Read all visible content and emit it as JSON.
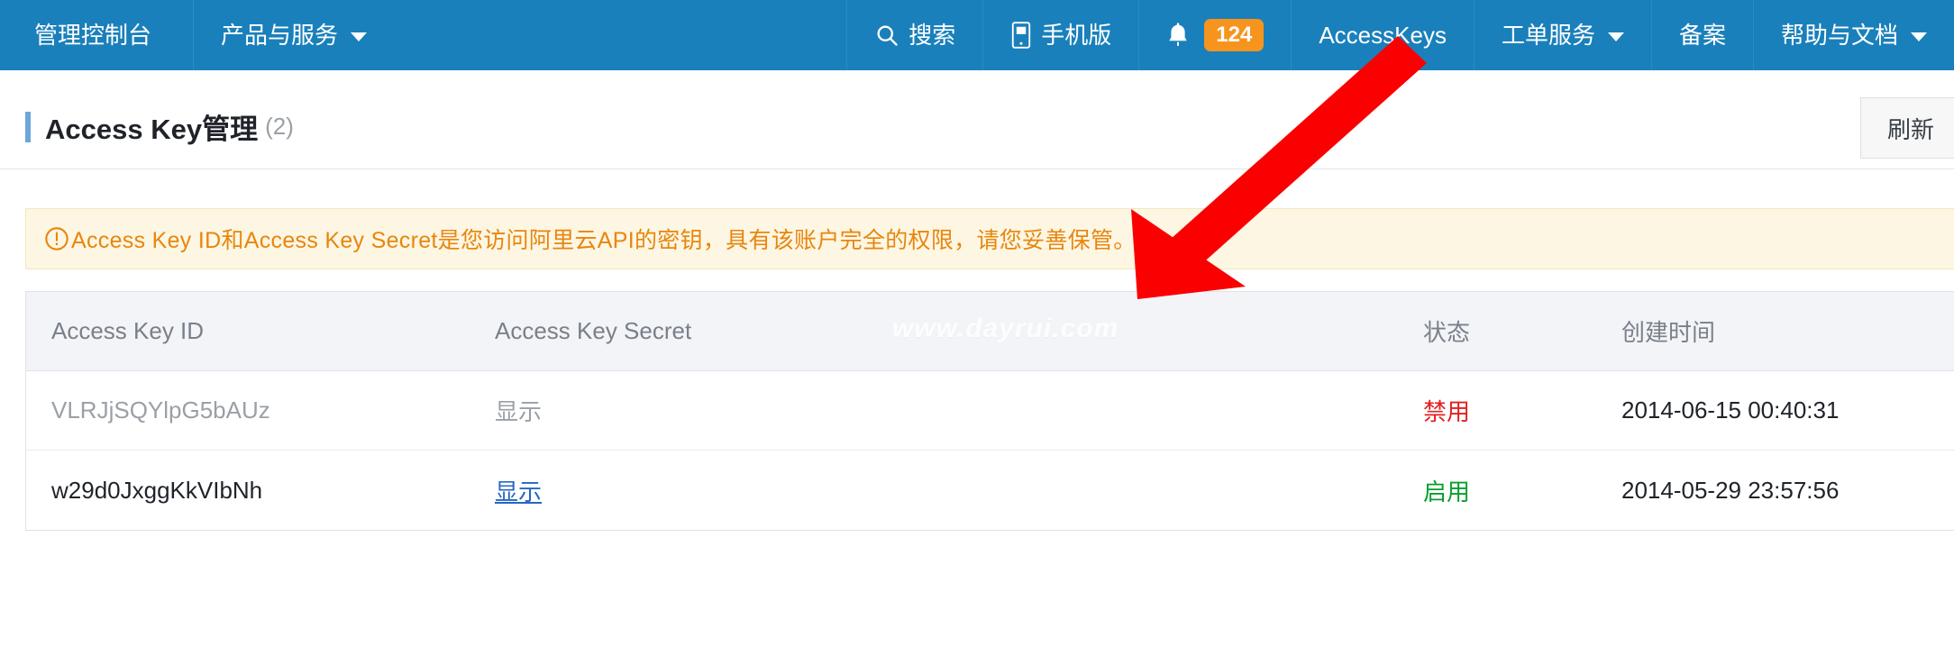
{
  "topnav": {
    "brand": "管理控制台",
    "products": "产品与服务",
    "search": "搜索",
    "mobile": "手机版",
    "notifications_count": "124",
    "accesskeys": "AccessKeys",
    "ticket_service": "工单服务",
    "beian": "备案",
    "help_docs": "帮助与文档",
    "background_color": "#1a80bb",
    "badge_color": "#f7941e"
  },
  "page": {
    "title": "Access Key管理",
    "count": "(2)",
    "refresh_label": "刷新",
    "accent_color": "#6ba7d8"
  },
  "alert": {
    "icon": "exclamation-circle-icon",
    "text": "Access Key ID和Access Key Secret是您访问阿里云API的密钥，具有该账户完全的权限，请您妥善保管。",
    "text_color": "#e8860d",
    "background_color": "#fdf6e3"
  },
  "table": {
    "columns": [
      "Access Key ID",
      "Access Key Secret",
      "状态",
      "创建时间"
    ],
    "rows": [
      {
        "access_key_id": "VLRJjSQYlpG5bAUz",
        "secret_action": "显示",
        "status": "禁用",
        "status_color": "#e02020",
        "created_at": "2014-06-15 00:40:31",
        "enabled": false
      },
      {
        "access_key_id": "w29d0JxggKkVIbNh",
        "secret_action": "显示",
        "status": "启用",
        "status_color": "#0a9e2c",
        "created_at": "2014-05-29 23:57:56",
        "enabled": true
      }
    ]
  },
  "watermark": {
    "text": "www.dayrui.com"
  },
  "annotation": {
    "arrow_color": "#fa0000"
  }
}
